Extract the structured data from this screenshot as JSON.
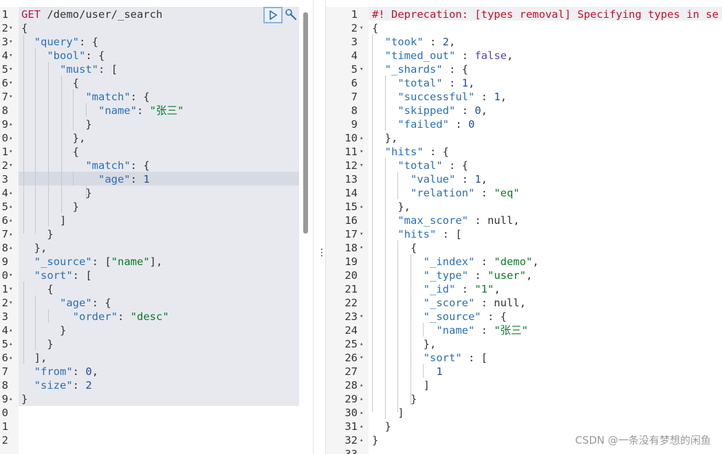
{
  "request": {
    "lines": [
      {
        "n": "1",
        "f": "",
        "code": [
          [
            "m",
            "GET"
          ],
          [
            "u",
            " /demo/user/_search"
          ]
        ]
      },
      {
        "n": "2",
        "f": "▾",
        "code": [
          [
            "u",
            "{"
          ]
        ]
      },
      {
        "n": "3",
        "f": "▾",
        "code": [
          [
            "u",
            "  "
          ],
          [
            "k",
            "\"query\""
          ],
          [
            "u",
            ": {"
          ]
        ]
      },
      {
        "n": "4",
        "f": "▾",
        "code": [
          [
            "u",
            "    "
          ],
          [
            "k",
            "\"bool\""
          ],
          [
            "u",
            ": {"
          ]
        ]
      },
      {
        "n": "5",
        "f": "▾",
        "code": [
          [
            "u",
            "      "
          ],
          [
            "k",
            "\"must\""
          ],
          [
            "u",
            ": ["
          ]
        ]
      },
      {
        "n": "6",
        "f": "▾",
        "code": [
          [
            "u",
            "        {"
          ]
        ]
      },
      {
        "n": "7",
        "f": "▾",
        "code": [
          [
            "u",
            "          "
          ],
          [
            "k",
            "\"match\""
          ],
          [
            "u",
            ": {"
          ]
        ]
      },
      {
        "n": "8",
        "f": "",
        "code": [
          [
            "u",
            "            "
          ],
          [
            "k",
            "\"name\""
          ],
          [
            "u",
            ": "
          ],
          [
            "s",
            "\"张三\""
          ]
        ]
      },
      {
        "n": "9",
        "f": "▴",
        "code": [
          [
            "u",
            "          }"
          ]
        ]
      },
      {
        "n": "0",
        "f": "▴",
        "code": [
          [
            "u",
            "        },"
          ]
        ]
      },
      {
        "n": "1",
        "f": "▾",
        "code": [
          [
            "u",
            "        {"
          ]
        ]
      },
      {
        "n": "2",
        "f": "▾",
        "code": [
          [
            "u",
            "          "
          ],
          [
            "k",
            "\"match\""
          ],
          [
            "u",
            ": {"
          ]
        ]
      },
      {
        "n": "3",
        "f": "",
        "code": [
          [
            "u",
            "            "
          ],
          [
            "k",
            "\"age\""
          ],
          [
            "u",
            ": "
          ],
          [
            "n",
            "1"
          ]
        ]
      },
      {
        "n": "4",
        "f": "▴",
        "code": [
          [
            "u",
            "          }"
          ]
        ]
      },
      {
        "n": "5",
        "f": "▴",
        "code": [
          [
            "u",
            "        }"
          ]
        ]
      },
      {
        "n": "6",
        "f": "▴",
        "code": [
          [
            "u",
            "      ]"
          ]
        ]
      },
      {
        "n": "7",
        "f": "▴",
        "code": [
          [
            "u",
            "    }"
          ]
        ]
      },
      {
        "n": "8",
        "f": "▴",
        "code": [
          [
            "u",
            "  },"
          ]
        ]
      },
      {
        "n": "9",
        "f": "",
        "code": [
          [
            "u",
            "  "
          ],
          [
            "k",
            "\"_source\""
          ],
          [
            "u",
            ": ["
          ],
          [
            "s",
            "\"name\""
          ],
          [
            "u",
            "],"
          ]
        ]
      },
      {
        "n": "0",
        "f": "▾",
        "code": [
          [
            "u",
            "  "
          ],
          [
            "k",
            "\"sort\""
          ],
          [
            "u",
            ": ["
          ]
        ]
      },
      {
        "n": "1",
        "f": "▾",
        "code": [
          [
            "u",
            "    {"
          ]
        ]
      },
      {
        "n": "2",
        "f": "▾",
        "code": [
          [
            "u",
            "      "
          ],
          [
            "k",
            "\"age\""
          ],
          [
            "u",
            ": {"
          ]
        ]
      },
      {
        "n": "3",
        "f": "",
        "code": [
          [
            "u",
            "        "
          ],
          [
            "k",
            "\"order\""
          ],
          [
            "u",
            ": "
          ],
          [
            "s",
            "\"desc\""
          ]
        ]
      },
      {
        "n": "4",
        "f": "▴",
        "code": [
          [
            "u",
            "      }"
          ]
        ]
      },
      {
        "n": "5",
        "f": "▴",
        "code": [
          [
            "u",
            "    }"
          ]
        ]
      },
      {
        "n": "6",
        "f": "▴",
        "code": [
          [
            "u",
            "  ],"
          ]
        ]
      },
      {
        "n": "7",
        "f": "",
        "code": [
          [
            "u",
            "  "
          ],
          [
            "k",
            "\"from\""
          ],
          [
            "u",
            ": "
          ],
          [
            "n",
            "0"
          ],
          [
            "u",
            ","
          ]
        ]
      },
      {
        "n": "8",
        "f": "",
        "code": [
          [
            "u",
            "  "
          ],
          [
            "k",
            "\"size\""
          ],
          [
            "u",
            ": "
          ],
          [
            "n",
            "2"
          ]
        ]
      },
      {
        "n": "9",
        "f": "▴",
        "code": [
          [
            "u",
            "}"
          ]
        ]
      },
      {
        "n": "0",
        "f": "",
        "code": []
      },
      {
        "n": "1",
        "f": "",
        "code": []
      },
      {
        "n": "2",
        "f": "",
        "code": []
      }
    ]
  },
  "response": {
    "lines": [
      {
        "n": "1",
        "f": "",
        "code": [
          [
            "err",
            "#! Deprecation: [types removal] Specifying types in se"
          ]
        ]
      },
      {
        "n": "2",
        "f": "▾",
        "code": [
          [
            "u",
            "{"
          ]
        ]
      },
      {
        "n": "3",
        "f": "",
        "code": [
          [
            "u",
            "  "
          ],
          [
            "k",
            "\"took\""
          ],
          [
            "u",
            " : "
          ],
          [
            "n",
            "2"
          ],
          [
            "u",
            ","
          ]
        ]
      },
      {
        "n": "4",
        "f": "",
        "code": [
          [
            "u",
            "  "
          ],
          [
            "k",
            "\"timed_out\""
          ],
          [
            "u",
            " : "
          ],
          [
            "kw",
            "false"
          ],
          [
            "u",
            ","
          ]
        ]
      },
      {
        "n": "5",
        "f": "▾",
        "code": [
          [
            "u",
            "  "
          ],
          [
            "k",
            "\"_shards\""
          ],
          [
            "u",
            " : {"
          ]
        ]
      },
      {
        "n": "6",
        "f": "",
        "code": [
          [
            "u",
            "    "
          ],
          [
            "k",
            "\"total\""
          ],
          [
            "u",
            " : "
          ],
          [
            "n",
            "1"
          ],
          [
            "u",
            ","
          ]
        ]
      },
      {
        "n": "7",
        "f": "",
        "code": [
          [
            "u",
            "    "
          ],
          [
            "k",
            "\"successful\""
          ],
          [
            "u",
            " : "
          ],
          [
            "n",
            "1"
          ],
          [
            "u",
            ","
          ]
        ]
      },
      {
        "n": "8",
        "f": "",
        "code": [
          [
            "u",
            "    "
          ],
          [
            "k",
            "\"skipped\""
          ],
          [
            "u",
            " : "
          ],
          [
            "n",
            "0"
          ],
          [
            "u",
            ","
          ]
        ]
      },
      {
        "n": "9",
        "f": "",
        "code": [
          [
            "u",
            "    "
          ],
          [
            "k",
            "\"failed\""
          ],
          [
            "u",
            " : "
          ],
          [
            "n",
            "0"
          ]
        ]
      },
      {
        "n": "10",
        "f": "▴",
        "code": [
          [
            "u",
            "  },"
          ]
        ]
      },
      {
        "n": "11",
        "f": "▾",
        "code": [
          [
            "u",
            "  "
          ],
          [
            "k",
            "\"hits\""
          ],
          [
            "u",
            " : {"
          ]
        ]
      },
      {
        "n": "12",
        "f": "▾",
        "code": [
          [
            "u",
            "    "
          ],
          [
            "k",
            "\"total\""
          ],
          [
            "u",
            " : {"
          ]
        ]
      },
      {
        "n": "13",
        "f": "",
        "code": [
          [
            "u",
            "      "
          ],
          [
            "k",
            "\"value\""
          ],
          [
            "u",
            " : "
          ],
          [
            "n",
            "1"
          ],
          [
            "u",
            ","
          ]
        ]
      },
      {
        "n": "14",
        "f": "",
        "code": [
          [
            "u",
            "      "
          ],
          [
            "k",
            "\"relation\""
          ],
          [
            "u",
            " : "
          ],
          [
            "s",
            "\"eq\""
          ]
        ]
      },
      {
        "n": "15",
        "f": "▴",
        "code": [
          [
            "u",
            "    },"
          ]
        ]
      },
      {
        "n": "16",
        "f": "",
        "code": [
          [
            "u",
            "    "
          ],
          [
            "k",
            "\"max_score\""
          ],
          [
            "u",
            " : null,"
          ]
        ]
      },
      {
        "n": "17",
        "f": "▾",
        "code": [
          [
            "u",
            "    "
          ],
          [
            "k",
            "\"hits\""
          ],
          [
            "u",
            " : ["
          ]
        ]
      },
      {
        "n": "18",
        "f": "▾",
        "code": [
          [
            "u",
            "      {"
          ]
        ]
      },
      {
        "n": "19",
        "f": "",
        "code": [
          [
            "u",
            "        "
          ],
          [
            "k",
            "\"_index\""
          ],
          [
            "u",
            " : "
          ],
          [
            "s",
            "\"demo\""
          ],
          [
            "u",
            ","
          ]
        ]
      },
      {
        "n": "20",
        "f": "",
        "code": [
          [
            "u",
            "        "
          ],
          [
            "k",
            "\"_type\""
          ],
          [
            "u",
            " : "
          ],
          [
            "s",
            "\"user\""
          ],
          [
            "u",
            ","
          ]
        ]
      },
      {
        "n": "21",
        "f": "",
        "code": [
          [
            "u",
            "        "
          ],
          [
            "k",
            "\"_id\""
          ],
          [
            "u",
            " : "
          ],
          [
            "s",
            "\"1\""
          ],
          [
            "u",
            ","
          ]
        ]
      },
      {
        "n": "22",
        "f": "",
        "code": [
          [
            "u",
            "        "
          ],
          [
            "k",
            "\"_score\""
          ],
          [
            "u",
            " : null,"
          ]
        ]
      },
      {
        "n": "23",
        "f": "▾",
        "code": [
          [
            "u",
            "        "
          ],
          [
            "k",
            "\"_source\""
          ],
          [
            "u",
            " : {"
          ]
        ]
      },
      {
        "n": "24",
        "f": "",
        "code": [
          [
            "u",
            "          "
          ],
          [
            "k",
            "\"name\""
          ],
          [
            "u",
            " : "
          ],
          [
            "s",
            "\"张三\""
          ]
        ]
      },
      {
        "n": "25",
        "f": "▴",
        "code": [
          [
            "u",
            "        },"
          ]
        ]
      },
      {
        "n": "26",
        "f": "▾",
        "code": [
          [
            "u",
            "        "
          ],
          [
            "k",
            "\"sort\""
          ],
          [
            "u",
            " : ["
          ]
        ]
      },
      {
        "n": "27",
        "f": "",
        "code": [
          [
            "u",
            "          "
          ],
          [
            "n",
            "1"
          ]
        ]
      },
      {
        "n": "28",
        "f": "▴",
        "code": [
          [
            "u",
            "        ]"
          ]
        ]
      },
      {
        "n": "29",
        "f": "▴",
        "code": [
          [
            "u",
            "      }"
          ]
        ]
      },
      {
        "n": "30",
        "f": "▴",
        "code": [
          [
            "u",
            "    ]"
          ]
        ]
      },
      {
        "n": "31",
        "f": "▴",
        "code": [
          [
            "u",
            "  }"
          ]
        ]
      },
      {
        "n": "32",
        "f": "▴",
        "code": [
          [
            "u",
            "}"
          ]
        ]
      },
      {
        "n": "33",
        "f": "",
        "code": []
      }
    ]
  },
  "watermark": "CSDN @一条没有梦想的闲鱼",
  "icons": {
    "run": "play-icon",
    "settings": "wrench-icon",
    "resize": "vertical-ellipsis-icon"
  }
}
